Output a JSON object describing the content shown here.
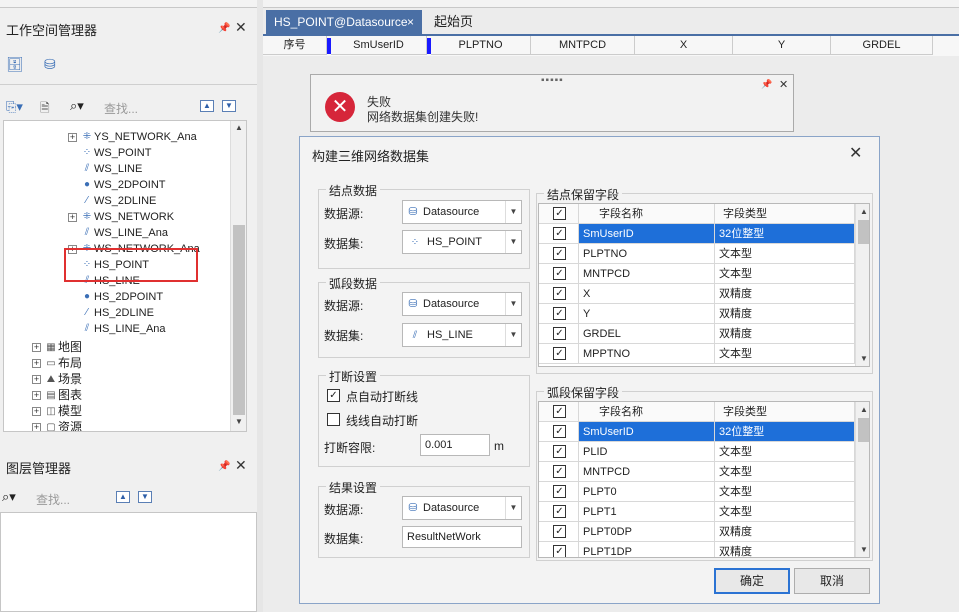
{
  "workspace": {
    "title": "工作空间管理器",
    "search_placeholder": "查找...",
    "tree": [
      {
        "label": "YS_NETWORK_Ana",
        "icon": "network-icon",
        "expand": "+"
      },
      {
        "label": "WS_POINT",
        "icon": "point-dataset-icon"
      },
      {
        "label": "WS_LINE",
        "icon": "line-dataset-icon"
      },
      {
        "label": "WS_2DPOINT",
        "icon": "2dpoint-icon"
      },
      {
        "label": "WS_2DLINE",
        "icon": "2dline-icon"
      },
      {
        "label": "WS_NETWORK",
        "icon": "network-icon",
        "expand": "+"
      },
      {
        "label": "WS_LINE_Ana",
        "icon": "line-dataset-icon"
      },
      {
        "label": "WS_NETWORK_Ana",
        "icon": "network-icon",
        "expand": "+"
      },
      {
        "label": "HS_POINT",
        "icon": "point-dataset-icon"
      },
      {
        "label": "HS_LINE",
        "icon": "line-dataset-icon"
      },
      {
        "label": "HS_2DPOINT",
        "icon": "2dpoint-icon"
      },
      {
        "label": "HS_2DLINE",
        "icon": "2dline-icon"
      },
      {
        "label": "HS_LINE_Ana",
        "icon": "line-dataset-icon"
      }
    ],
    "root_nodes": [
      "地图",
      "布局",
      "场景",
      "图表",
      "模型",
      "资源"
    ]
  },
  "layers": {
    "title": "图层管理器",
    "search_placeholder": "查找..."
  },
  "tabs": {
    "active": "HS_POINT@Datasource",
    "other": "起始页",
    "close": "×"
  },
  "table": {
    "columns": [
      "序号",
      "SmUserID",
      "PLPTNO",
      "MNTPCD",
      "X",
      "Y",
      "GRDEL"
    ]
  },
  "notify": {
    "title": "失败",
    "message": "网络数据集创建失败!"
  },
  "dialog": {
    "title": "构建三维网络数据集",
    "node_group": "结点数据",
    "arc_group": "弧段数据",
    "break_group": "打断设置",
    "result_group": "结果设置",
    "datasource_label": "数据源:",
    "dataset_label": "数据集:",
    "node_datasource": "Datasource",
    "node_dataset": "HS_POINT",
    "arc_datasource": "Datasource",
    "arc_dataset": "HS_LINE",
    "break_point_auto": "点自动打断线",
    "break_line_auto": "线线自动打断",
    "tolerance_label": "打断容限:",
    "tolerance_value": "0.001",
    "tolerance_unit": "m",
    "result_datasource": "Datasource",
    "result_dataset": "ResultNetWork",
    "node_fields_group": "结点保留字段",
    "arc_fields_group": "弧段保留字段",
    "col_name": "字段名称",
    "col_type": "字段类型",
    "node_fields": [
      {
        "name": "SmUserID",
        "type": "32位整型"
      },
      {
        "name": "PLPTNO",
        "type": "文本型"
      },
      {
        "name": "MNTPCD",
        "type": "文本型"
      },
      {
        "name": "X",
        "type": "双精度"
      },
      {
        "name": "Y",
        "type": "双精度"
      },
      {
        "name": "GRDEL",
        "type": "双精度"
      },
      {
        "name": "MPPTNO",
        "type": "文本型"
      }
    ],
    "arc_fields": [
      {
        "name": "SmUserID",
        "type": "32位整型"
      },
      {
        "name": "PLID",
        "type": "文本型"
      },
      {
        "name": "MNTPCD",
        "type": "文本型"
      },
      {
        "name": "PLPT0",
        "type": "文本型"
      },
      {
        "name": "PLPT1",
        "type": "文本型"
      },
      {
        "name": "PLPT0DP",
        "type": "双精度"
      },
      {
        "name": "PLPT1DP",
        "type": "双精度"
      }
    ],
    "ok": "确定",
    "cancel": "取消"
  }
}
